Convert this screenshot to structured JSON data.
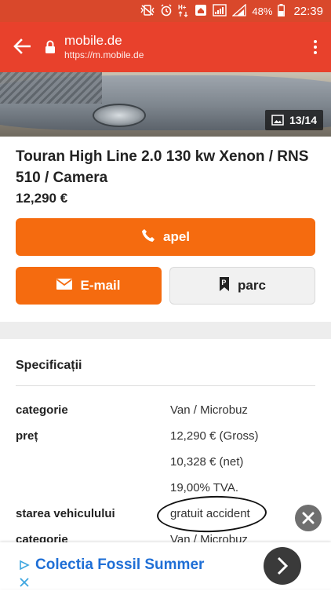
{
  "status_bar": {
    "battery": "48%",
    "time": "22:39",
    "icons": [
      "mute-vibrate-icon",
      "alarm-icon",
      "data-hplus-icon",
      "signal-icon",
      "signal-icon",
      "battery-icon"
    ]
  },
  "browser": {
    "domain": "mobile.de",
    "url": "https://m.mobile.de"
  },
  "gallery": {
    "counter": "13/14"
  },
  "listing": {
    "title": "Touran High Line 2.0 130 kw Xenon / RNS 510 / Camera",
    "price": "12,290 €"
  },
  "actions": {
    "call_label": "apel",
    "email_label": "E-mail",
    "park_label": "parc"
  },
  "specs": {
    "heading": "Specificații",
    "rows": [
      {
        "label": "categorie",
        "value": "Van / Microbuz"
      },
      {
        "label": "preț",
        "value": "12,290 € (Gross)"
      },
      {
        "label": "",
        "value": "10,328 € (net)"
      },
      {
        "label": "",
        "value": "19,00% TVA."
      },
      {
        "label": "starea vehiculului",
        "value": "gratuit accident"
      },
      {
        "label": "categorie",
        "value": "Van / Microbuz"
      }
    ]
  },
  "ad": {
    "title": "Colectia Fossil Summer"
  },
  "colors": {
    "brand_red": "#e8412c",
    "button_orange": "#f56b0f",
    "ad_blue": "#1f6fd6"
  }
}
